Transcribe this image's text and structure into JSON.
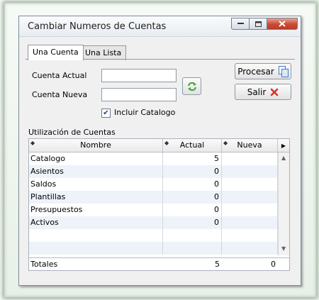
{
  "window": {
    "title": "Cambiar Numeros de Cuentas"
  },
  "tabs": [
    {
      "label": "Una Cuenta",
      "active": true
    },
    {
      "label": "Una Lista",
      "active": false
    }
  ],
  "form": {
    "cuenta_actual_label": "Cuenta Actual",
    "cuenta_actual_value": "",
    "cuenta_nueva_label": "Cuenta Nueva",
    "cuenta_nueva_value": "",
    "incluir_catalogo_label": "Incluir Catalogo",
    "incluir_catalogo_checked": true
  },
  "buttons": {
    "procesar": "Procesar",
    "salir": "Salir"
  },
  "table": {
    "section_label": "Utilización de Cuentas",
    "columns": [
      "Nombre",
      "Actual",
      "Nueva"
    ],
    "rows": [
      {
        "nombre": "Catalogo",
        "actual": "5",
        "nueva": ""
      },
      {
        "nombre": "Asientos",
        "actual": "0",
        "nueva": ""
      },
      {
        "nombre": "Saldos",
        "actual": "0",
        "nueva": ""
      },
      {
        "nombre": "Plantillas",
        "actual": "0",
        "nueva": ""
      },
      {
        "nombre": "Presupuestos",
        "actual": "0",
        "nueva": ""
      },
      {
        "nombre": "Activos",
        "actual": "0",
        "nueva": ""
      }
    ],
    "totals": {
      "label": "Totales",
      "actual": "5",
      "nueva": "0"
    }
  },
  "colors": {
    "close_button": "#c94a32",
    "row_alt": "#eef3fa",
    "swap_icon": "#3aa63a",
    "salir_icon": "#d83030",
    "procesar_icon": "#3d78c8"
  },
  "icons": {
    "swap": "swap-arrows-icon",
    "procesar": "document-copy-icon",
    "salir": "red-x-icon"
  }
}
